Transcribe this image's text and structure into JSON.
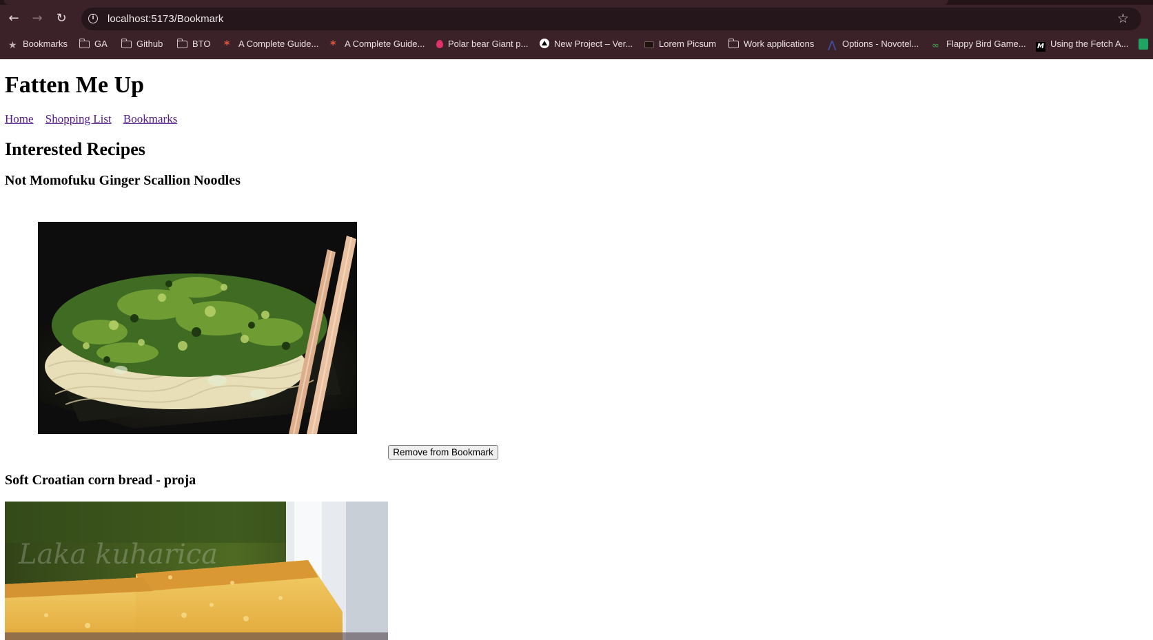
{
  "browser": {
    "url": "localhost:5173/Bookmark",
    "bookmarks": [
      {
        "label": "Bookmarks",
        "icon": "star-icon"
      },
      {
        "label": "GA",
        "icon": "folder-icon"
      },
      {
        "label": "Github",
        "icon": "folder-icon"
      },
      {
        "label": "BTO",
        "icon": "folder-icon"
      },
      {
        "label": "A Complete Guide...",
        "icon": "asterisk-icon"
      },
      {
        "label": "A Complete Guide...",
        "icon": "asterisk-icon"
      },
      {
        "label": "Polar bear Giant p...",
        "icon": "drop-icon"
      },
      {
        "label": "New Project – Ver...",
        "icon": "vercel-icon"
      },
      {
        "label": "Lorem Picsum",
        "icon": "picsum-icon"
      },
      {
        "label": "Work applications",
        "icon": "folder-icon"
      },
      {
        "label": "Options - Novotel...",
        "icon": "novotel-icon"
      },
      {
        "label": "Flappy Bird Game...",
        "icon": "flappy-icon"
      },
      {
        "label": "Using the Fetch A...",
        "icon": "mdn-icon"
      }
    ]
  },
  "page": {
    "site_title": "Fatten Me Up",
    "nav": [
      {
        "label": "Home"
      },
      {
        "label": "Shopping List"
      },
      {
        "label": "Bookmarks"
      }
    ],
    "heading": "Interested Recipes",
    "recipes": [
      {
        "title": "Not Momofuku Ginger Scallion Noodles",
        "image": "noodles-image",
        "button_label": "Remove from Bookmark"
      },
      {
        "title": "Soft Croatian corn bread - proja",
        "image": "cornbread-image"
      }
    ]
  }
}
